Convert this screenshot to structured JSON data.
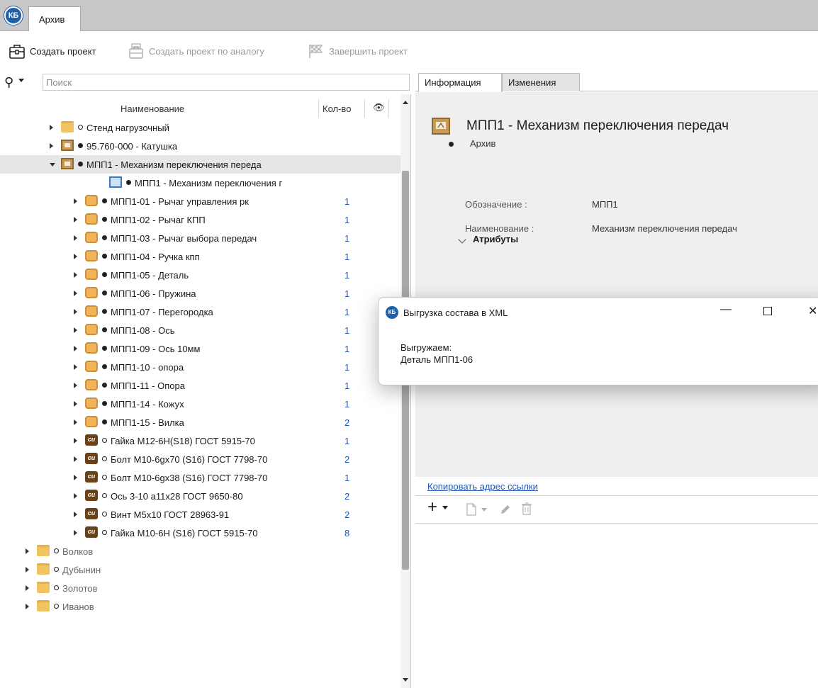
{
  "app": {
    "logo_text": "КБ",
    "tab_label": "Архив"
  },
  "toolbar": {
    "create_project": "Создать проект",
    "create_by_analog": "Создать проект по аналогу",
    "finish_project": "Завершить проект"
  },
  "search": {
    "placeholder": "Поиск"
  },
  "tree": {
    "columns": {
      "name": "Наименование",
      "qty": "Кол-во",
      "visibility_icon": "eye-icon"
    },
    "rows": [
      {
        "indent": 2,
        "expander": "closed",
        "icon": "folder",
        "dot": "hollow",
        "label": "Стенд нагрузочный",
        "qty": "",
        "muted": false
      },
      {
        "indent": 2,
        "expander": "closed",
        "icon": "assembly",
        "dot": "filled",
        "label": "95.760-000 - Катушка",
        "qty": "",
        "muted": false
      },
      {
        "indent": 2,
        "expander": "open",
        "icon": "assembly",
        "dot": "filled",
        "label": "МПП1 - Механизм переключения переда",
        "qty": "",
        "muted": false,
        "selected": true
      },
      {
        "indent": 4,
        "expander": "none",
        "icon": "assembly-doc",
        "dot": "filled",
        "label": "МПП1 - Механизм переключения г",
        "qty": "",
        "muted": false
      },
      {
        "indent": 3,
        "expander": "closed",
        "icon": "part",
        "dot": "filled",
        "label": "МПП1-01 - Рычаг управления рк",
        "qty": "1",
        "muted": false
      },
      {
        "indent": 3,
        "expander": "closed",
        "icon": "part",
        "dot": "filled",
        "label": "МПП1-02 - Рычаг КПП",
        "qty": "1",
        "muted": false
      },
      {
        "indent": 3,
        "expander": "closed",
        "icon": "part",
        "dot": "filled",
        "label": "МПП1-03 - Рычаг выбора передач",
        "qty": "1",
        "muted": false
      },
      {
        "indent": 3,
        "expander": "closed",
        "icon": "part",
        "dot": "filled",
        "label": "МПП1-04 - Ручка кпп",
        "qty": "1",
        "muted": false
      },
      {
        "indent": 3,
        "expander": "closed",
        "icon": "part",
        "dot": "filled",
        "label": "МПП1-05 - Деталь",
        "qty": "1",
        "muted": false
      },
      {
        "indent": 3,
        "expander": "closed",
        "icon": "part",
        "dot": "filled",
        "label": "МПП1-06 - Пружина",
        "qty": "1",
        "muted": false
      },
      {
        "indent": 3,
        "expander": "closed",
        "icon": "part",
        "dot": "filled",
        "label": "МПП1-07 - Перегородка",
        "qty": "1",
        "muted": false
      },
      {
        "indent": 3,
        "expander": "closed",
        "icon": "part",
        "dot": "filled",
        "label": "МПП1-08 - Ось",
        "qty": "1",
        "muted": false
      },
      {
        "indent": 3,
        "expander": "closed",
        "icon": "part",
        "dot": "filled",
        "label": "МПП1-09 - Ось 10мм",
        "qty": "1",
        "muted": false
      },
      {
        "indent": 3,
        "expander": "closed",
        "icon": "part",
        "dot": "filled",
        "label": "МПП1-10 - опора",
        "qty": "1",
        "muted": false
      },
      {
        "indent": 3,
        "expander": "closed",
        "icon": "part",
        "dot": "filled",
        "label": "МПП1-11 - Опора",
        "qty": "1",
        "muted": false
      },
      {
        "indent": 3,
        "expander": "closed",
        "icon": "part",
        "dot": "filled",
        "label": "МПП1-14 - Кожух",
        "qty": "1",
        "muted": false
      },
      {
        "indent": 3,
        "expander": "closed",
        "icon": "part",
        "dot": "filled",
        "label": "МПП1-15 - Вилка",
        "qty": "2",
        "muted": false
      },
      {
        "indent": 3,
        "expander": "closed",
        "icon": "standard",
        "dot": "hollow",
        "label": "Гайка М12-6Н(S18) ГОСТ 5915-70",
        "qty": "1",
        "muted": false
      },
      {
        "indent": 3,
        "expander": "closed",
        "icon": "standard",
        "dot": "hollow",
        "label": "Болт М10-6gx70 (S16) ГОСТ 7798-70",
        "qty": "2",
        "muted": false
      },
      {
        "indent": 3,
        "expander": "closed",
        "icon": "standard",
        "dot": "hollow",
        "label": "Болт М10-6gx38 (S16) ГОСТ 7798-70",
        "qty": "1",
        "muted": false
      },
      {
        "indent": 3,
        "expander": "closed",
        "icon": "standard",
        "dot": "hollow",
        "label": "Ось 3-10 а11х28 ГОСТ 9650-80",
        "qty": "2",
        "muted": false
      },
      {
        "indent": 3,
        "expander": "closed",
        "icon": "standard",
        "dot": "hollow",
        "label": "Винт М5х10 ГОСТ 28963-91",
        "qty": "2",
        "muted": false
      },
      {
        "indent": 3,
        "expander": "closed",
        "icon": "standard",
        "dot": "hollow",
        "label": "Гайка М10-6Н (S16) ГОСТ 5915-70",
        "qty": "8",
        "muted": false
      },
      {
        "indent": 1,
        "expander": "closed",
        "icon": "folder",
        "dot": "hollow",
        "label": "Волков",
        "qty": "",
        "muted": true
      },
      {
        "indent": 1,
        "expander": "closed",
        "icon": "folder",
        "dot": "hollow",
        "label": "Дубынин",
        "qty": "",
        "muted": true
      },
      {
        "indent": 1,
        "expander": "closed",
        "icon": "folder",
        "dot": "hollow",
        "label": "Золотов",
        "qty": "",
        "muted": true
      },
      {
        "indent": 1,
        "expander": "closed",
        "icon": "folder",
        "dot": "hollow",
        "label": "Иванов",
        "qty": "",
        "muted": true
      }
    ],
    "std_icon_text": "си"
  },
  "details": {
    "tabs": [
      "Информация",
      "Изменения"
    ],
    "title": "МПП1 - Механизм переключения передач",
    "state": "Архив",
    "properties": [
      {
        "label": "Обозначение :",
        "value": "МПП1"
      },
      {
        "label": "Наименование :",
        "value": "Механизм переключения передач"
      }
    ],
    "attributes_title": "Атрибуты",
    "copy_link": "Копировать адрес ссылки"
  },
  "dialog": {
    "title": "Выгрузка состава в XML",
    "line1": "Выгружаем:",
    "line2": "Деталь МПП1-06",
    "min_glyph": "—",
    "close_glyph": "✕"
  },
  "colors": {
    "link": "#1f56b8",
    "tabstrip": "#c8c8c8",
    "selection": "#e6e6e6",
    "info_bg": "#efefef"
  }
}
